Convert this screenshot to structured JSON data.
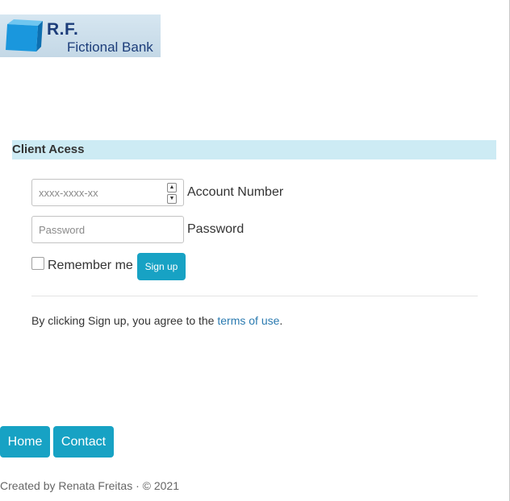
{
  "logo": {
    "line1": "R.F.",
    "line2": "Fictional Bank"
  },
  "section": {
    "title": "Client Acess"
  },
  "account": {
    "placeholder": "xxxx-xxxx-xx",
    "label": "Account Number"
  },
  "password": {
    "placeholder": "Password",
    "label": "Password"
  },
  "remember": {
    "label": "Remember me",
    "checked": false
  },
  "signup_button": "Sign up",
  "terms": {
    "prefix": "By clicking Sign up, you agree to the ",
    "link": "terms of use",
    "suffix": "."
  },
  "nav": {
    "home": "Home",
    "contact": "Contact"
  },
  "footer": "Created by Renata Freitas · © 2021",
  "colors": {
    "accent": "#17a2c4",
    "section_bg": "#cdebf4",
    "link": "#2a7ab0",
    "logo_text": "#1c3d7a"
  },
  "icons": {
    "logo": "blue-cube-icon",
    "spinner_up": "chevron-up-icon",
    "spinner_down": "chevron-down-icon"
  }
}
